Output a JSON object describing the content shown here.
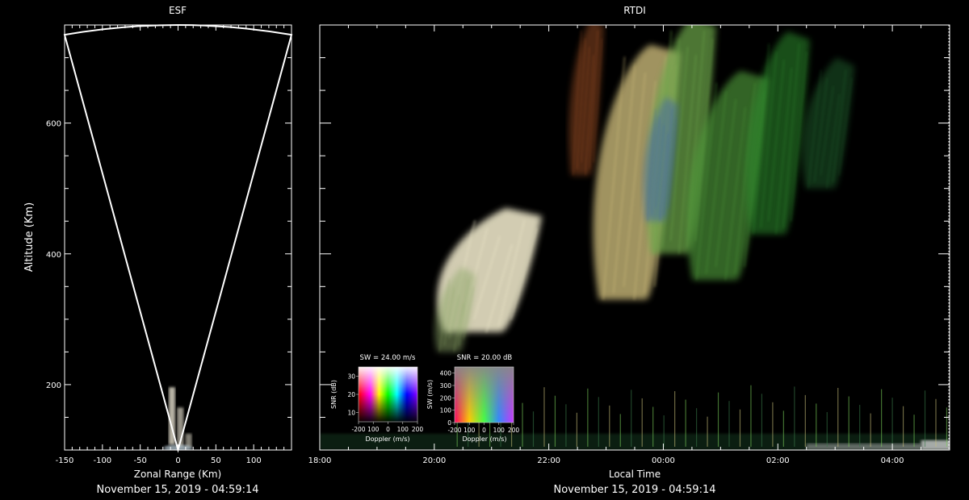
{
  "colors": {
    "background": "#000000",
    "frame": "#ffffff"
  },
  "chart_data": [
    {
      "type": "scatter",
      "title": "ESF",
      "xlabel": "Zonal Range (Km)",
      "ylabel": "Altitude (Km)",
      "caption": "November 15, 2019 - 04:59:14",
      "xlim": [
        -150,
        150
      ],
      "ylim": [
        100,
        750
      ],
      "xticks": [
        -150,
        -100,
        -50,
        0,
        50,
        100
      ],
      "yticks": [
        200,
        400,
        600
      ],
      "xtick_labels": [
        "-150",
        "-100",
        "-50",
        "0",
        "50",
        "100"
      ],
      "ytick_labels": [
        "200",
        "400",
        "600"
      ],
      "fan_outline": {
        "apex": [
          0,
          100
        ],
        "left_edge": [
          -150,
          735
        ],
        "right_edge": [
          150,
          735
        ],
        "arc_top_altitude": 750
      },
      "echoes": [
        {
          "x": -8,
          "y0": 108,
          "y1": 196,
          "intensity": 0.85
        },
        {
          "x": 3,
          "y0": 105,
          "y1": 165,
          "intensity": 0.7
        },
        {
          "x": 14,
          "y0": 104,
          "y1": 125,
          "intensity": 0.6
        }
      ]
    },
    {
      "type": "heatmap",
      "title": "RTDI",
      "xlabel": "Local Time",
      "caption": "November 15, 2019 - 04:59:14",
      "xlim": [
        "18:00",
        "05:00"
      ],
      "ylim": [
        100,
        750
      ],
      "xtick_labels": [
        "18:00",
        "20:00",
        "22:00",
        "00:00",
        "02:00",
        "04:00"
      ],
      "xtick_hours": [
        0,
        2,
        4,
        6,
        8,
        10
      ],
      "yticks": [
        200,
        400,
        600
      ],
      "plumes": [
        {
          "t": 2.8,
          "alt0": 280,
          "alt1": 470,
          "width": 1.8,
          "color": "#e9e3c6",
          "intensity": 0.9
        },
        {
          "t": 2.3,
          "alt0": 250,
          "alt1": 380,
          "width": 0.7,
          "color": "#8fa86a",
          "intensity": 0.5
        },
        {
          "t": 5.4,
          "alt0": 330,
          "alt1": 720,
          "width": 1.5,
          "color": "#c9b878",
          "intensity": 0.8
        },
        {
          "t": 6.2,
          "alt0": 400,
          "alt1": 760,
          "width": 1.2,
          "color": "#6ea84c",
          "intensity": 0.7
        },
        {
          "t": 7.0,
          "alt0": 360,
          "alt1": 680,
          "width": 1.4,
          "color": "#4f9a3a",
          "intensity": 0.65
        },
        {
          "t": 7.9,
          "alt0": 430,
          "alt1": 740,
          "width": 1.1,
          "color": "#2f8e2f",
          "intensity": 0.55
        },
        {
          "t": 8.8,
          "alt0": 500,
          "alt1": 700,
          "width": 0.9,
          "color": "#2a7a3a",
          "intensity": 0.4
        },
        {
          "t": 5.9,
          "alt0": 450,
          "alt1": 640,
          "width": 0.6,
          "color": "#3a5fb8",
          "intensity": 0.45
        },
        {
          "t": 4.6,
          "alt0": 520,
          "alt1": 760,
          "width": 0.6,
          "color": "#b05a2a",
          "intensity": 0.45
        }
      ],
      "bottom_layer": {
        "alt0": 100,
        "alt1": 125,
        "intensity": 0.7
      },
      "insets": [
        {
          "title": "SW = 24.00 m/s",
          "xlabel": "Doppler (m/s)",
          "ylabel": "SNR (dB)",
          "xtick_labels": [
            "-200",
            "100",
            "0",
            "100",
            "200"
          ],
          "ytick_labels": [
            "10",
            "20",
            "30"
          ],
          "yticks": [
            10,
            20,
            30
          ],
          "ylim": [
            5,
            35
          ]
        },
        {
          "title": "SNR = 20.00 dB",
          "xlabel": "Doppler (m/s)",
          "ylabel": "SW (m/s)",
          "xtick_labels": [
            "-200",
            "100",
            "0",
            "100",
            "200"
          ],
          "ytick_labels": [
            "0",
            "100",
            "200",
            "300",
            "400"
          ],
          "yticks": [
            0,
            100,
            200,
            300,
            400
          ],
          "ylim": [
            0,
            450
          ]
        }
      ]
    }
  ]
}
